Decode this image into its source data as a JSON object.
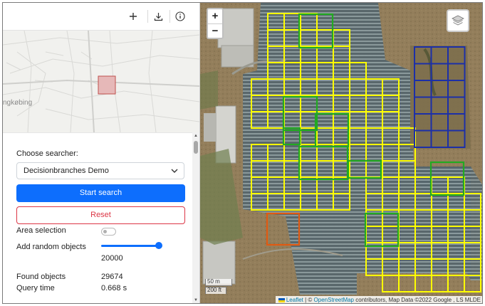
{
  "toolbar": {
    "icons": [
      "plus-icon",
      "download-icon",
      "info-icon"
    ]
  },
  "minimap": {
    "place_label": "ngkøbing"
  },
  "panel": {
    "choose_searcher_label": "Choose searcher:",
    "searcher_selected": "Decisionbranches Demo",
    "start_search_label": "Start search",
    "reset_label": "Reset",
    "area_selection_label": "Area selection",
    "area_selection_on": false,
    "add_random_objects_label": "Add random objects",
    "random_objects_value": "20000",
    "found_objects_label": "Found objects",
    "found_objects_value": "29674",
    "query_time_label": "Query time",
    "query_time_value": "0.668 s"
  },
  "map": {
    "zoom_in_label": "+",
    "zoom_out_label": "−",
    "scale_metric": "50 m",
    "scale_imperial": "200 ft",
    "attribution": {
      "leaflet": "Leaflet",
      "separator": " | © ",
      "osm": "OpenStreetMap",
      "rest": " contributors, Map Data ©2022 Google , LS MLDE"
    }
  },
  "colors": {
    "accent": "#0d6efd",
    "danger": "#dc3545",
    "grid_yellow": "#ffff00",
    "grid_green": "#22aa22",
    "grid_blue": "#1c2fa8",
    "grid_orange": "#e05a12"
  }
}
